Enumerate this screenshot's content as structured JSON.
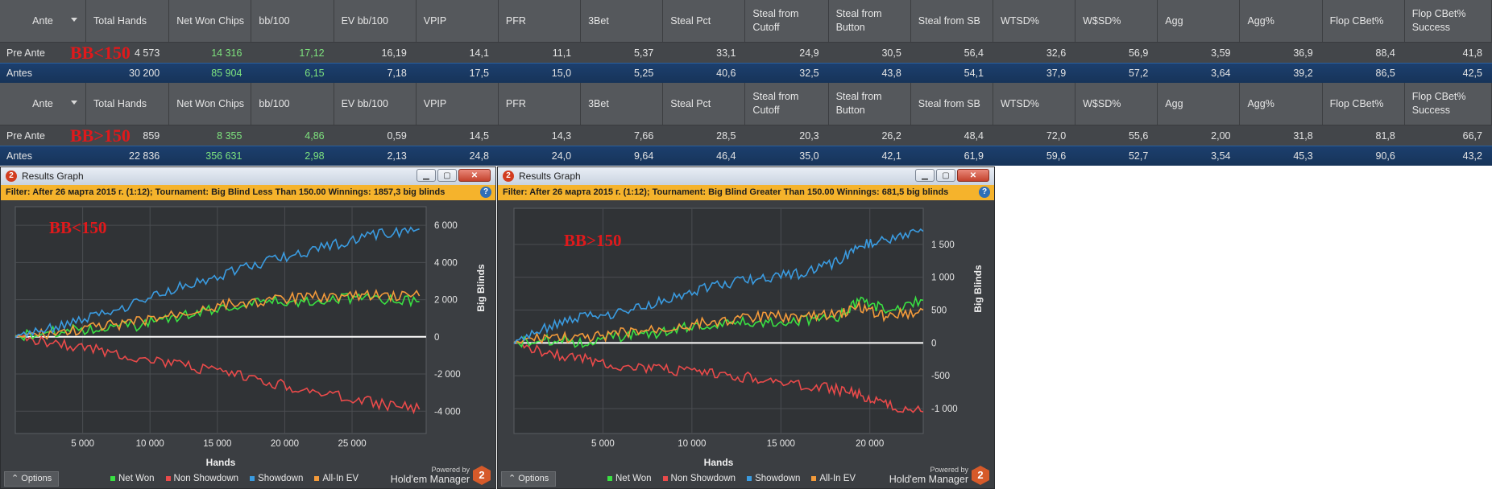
{
  "stats_headers": [
    "Ante",
    "Total Hands",
    "Net Won Chips",
    "bb/100",
    "EV bb/100",
    "VPIP",
    "PFR",
    "3Bet",
    "Steal Pct",
    "Steal from Cutoff",
    "Steal from Button",
    "Steal from SB",
    "WTSD%",
    "W$SD%",
    "Agg",
    "Agg%",
    "Flop CBet%",
    "Flop CBet% Success"
  ],
  "table1": {
    "label": "BB<150",
    "rows": [
      [
        "Pre Ante",
        "4 573",
        "14 316",
        "17,12",
        "16,19",
        "14,1",
        "11,1",
        "5,37",
        "33,1",
        "24,9",
        "30,5",
        "56,4",
        "32,6",
        "56,9",
        "3,59",
        "36,9",
        "88,4",
        "41,8"
      ],
      [
        "Antes",
        "30 200",
        "85 904",
        "6,15",
        "7,18",
        "17,5",
        "15,0",
        "5,25",
        "40,6",
        "32,5",
        "43,8",
        "54,1",
        "37,9",
        "57,2",
        "3,64",
        "39,2",
        "86,5",
        "42,5"
      ]
    ]
  },
  "table2": {
    "label": "BB>150",
    "rows": [
      [
        "Pre Ante",
        "859",
        "8 355",
        "4,86",
        "0,59",
        "14,5",
        "14,3",
        "7,66",
        "28,5",
        "20,3",
        "26,2",
        "48,4",
        "72,0",
        "55,6",
        "2,00",
        "31,8",
        "81,8",
        "66,7"
      ],
      [
        "Antes",
        "22 836",
        "356 631",
        "2,98",
        "2,13",
        "24,8",
        "24,0",
        "9,64",
        "46,4",
        "35,0",
        "42,1",
        "61,9",
        "59,6",
        "52,7",
        "3,54",
        "45,3",
        "90,6",
        "43,2"
      ]
    ]
  },
  "window_title": "Results Graph",
  "options_label": "Options",
  "powered_by": "Powered by",
  "brand": "Hold'em Manager",
  "brand_badge": "2",
  "legend": [
    {
      "name": "Net Won",
      "color": "#39e042"
    },
    {
      "name": "Non Showdown",
      "color": "#ea4a4a"
    },
    {
      "name": "Showdown",
      "color": "#3a9be0"
    },
    {
      "name": "All-In EV",
      "color": "#f39a3a"
    }
  ],
  "graph1": {
    "filter": "Filter: After 26 марта 2015 г. (1:12); Tournament: Big Blind Less Than 150.00 Winnings: 1857,3 big blinds",
    "label": "BB<150",
    "chart_data": {
      "type": "line",
      "xlabel": "Hands",
      "ylabel": "Big Blinds",
      "xlim": [
        0,
        30500
      ],
      "ylim": [
        -5200,
        7000
      ],
      "xticks": [
        5000,
        10000,
        15000,
        20000,
        25000
      ],
      "xtick_labels": [
        "5 000",
        "10 000",
        "15 000",
        "20 000",
        "25 000"
      ],
      "yticks": [
        6000,
        4000,
        2000,
        0,
        -2000,
        -4000
      ],
      "ytick_labels": [
        "6 000",
        "4 000",
        "2 000",
        "0",
        "-2 000",
        "-4 000"
      ],
      "series": [
        {
          "name": "Showdown",
          "color": "#3a9be0",
          "x": [
            0,
            3000,
            6000,
            9000,
            12000,
            15000,
            18000,
            21000,
            24000,
            27000,
            30000
          ],
          "y": [
            0,
            500,
            1100,
            1800,
            2600,
            3300,
            3900,
            4500,
            5000,
            5500,
            5800
          ]
        },
        {
          "name": "All-In EV",
          "color": "#f39a3a",
          "x": [
            0,
            3000,
            6000,
            9000,
            12000,
            15000,
            18000,
            21000,
            24000,
            27000,
            30000
          ],
          "y": [
            0,
            200,
            500,
            800,
            1200,
            1700,
            1900,
            2100,
            2200,
            2200,
            2200
          ]
        },
        {
          "name": "Net Won",
          "color": "#39e042",
          "x": [
            0,
            3000,
            6000,
            9000,
            12000,
            15000,
            18000,
            21000,
            24000,
            27000,
            30000
          ],
          "y": [
            0,
            300,
            450,
            600,
            1100,
            1500,
            1900,
            1900,
            2100,
            2000,
            1900
          ]
        },
        {
          "name": "Non Showdown",
          "color": "#ea4a4a",
          "x": [
            0,
            3000,
            6000,
            9000,
            12000,
            15000,
            18000,
            21000,
            24000,
            27000,
            30000
          ],
          "y": [
            0,
            -300,
            -700,
            -1100,
            -1500,
            -1900,
            -2300,
            -2800,
            -3200,
            -3600,
            -3900
          ]
        }
      ]
    }
  },
  "graph2": {
    "filter": "Filter: After 26 марта 2015 г. (1:12); Tournament: Big Blind Greater Than 150.00 Winnings: 681,5 big blinds",
    "label": "BB>150",
    "chart_data": {
      "type": "line",
      "xlabel": "Hands",
      "ylabel": "Big Blinds",
      "xlim": [
        0,
        23000
      ],
      "ylim": [
        -1380,
        2050
      ],
      "xticks": [
        5000,
        10000,
        15000,
        20000
      ],
      "xtick_labels": [
        "5 000",
        "10 000",
        "15 000",
        "20 000"
      ],
      "yticks": [
        1500,
        1000,
        500,
        0,
        -500,
        -1000
      ],
      "ytick_labels": [
        "1 500",
        "1 000",
        "500",
        "0",
        "-500",
        "-1 000"
      ],
      "series": [
        {
          "name": "Showdown",
          "color": "#3a9be0",
          "x": [
            0,
            2000,
            4000,
            6000,
            8000,
            10000,
            12000,
            14000,
            16000,
            18000,
            19500,
            21000,
            23000
          ],
          "y": [
            0,
            250,
            400,
            450,
            600,
            800,
            900,
            1000,
            1050,
            1200,
            1500,
            1550,
            1700
          ]
        },
        {
          "name": "All-In EV",
          "color": "#f39a3a",
          "x": [
            0,
            2000,
            4000,
            6000,
            8000,
            10000,
            12000,
            14000,
            16000,
            18000,
            19500,
            21000,
            23000
          ],
          "y": [
            0,
            100,
            60,
            150,
            200,
            280,
            350,
            400,
            400,
            420,
            550,
            400,
            500
          ]
        },
        {
          "name": "Net Won",
          "color": "#39e042",
          "x": [
            0,
            2000,
            4000,
            6000,
            8000,
            10000,
            12000,
            14000,
            16000,
            18000,
            19500,
            21000,
            23000
          ],
          "y": [
            0,
            50,
            0,
            100,
            150,
            250,
            300,
            320,
            350,
            350,
            650,
            500,
            650
          ]
        },
        {
          "name": "Non Showdown",
          "color": "#ea4a4a",
          "x": [
            0,
            2000,
            4000,
            6000,
            8000,
            10000,
            12000,
            14000,
            16000,
            18000,
            19500,
            21000,
            23000
          ],
          "y": [
            0,
            -150,
            -250,
            -350,
            -400,
            -450,
            -500,
            -550,
            -650,
            -700,
            -800,
            -950,
            -1050
          ]
        }
      ]
    }
  }
}
